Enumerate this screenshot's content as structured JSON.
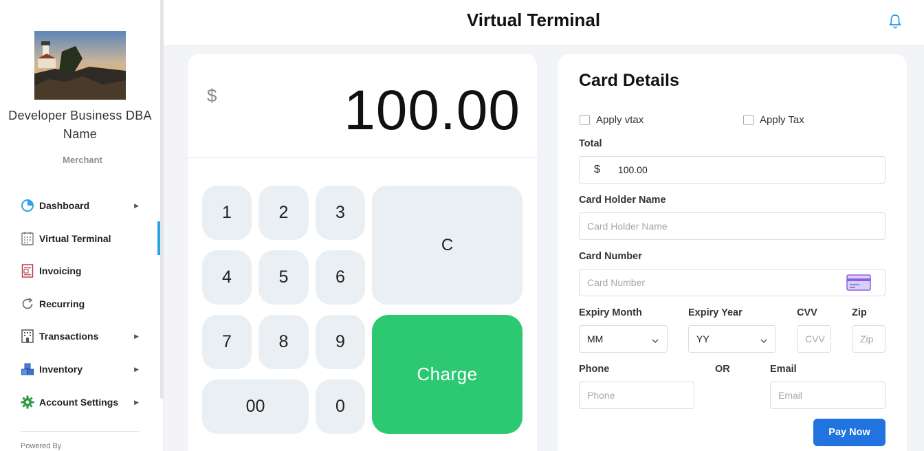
{
  "header": {
    "title": "Virtual Terminal",
    "bell_icon": "bell-icon"
  },
  "sidebar": {
    "business_name": "Developer Business DBA Name",
    "role": "Merchant",
    "powered_by": "Powered By",
    "items": [
      {
        "label": "Dashboard",
        "icon": "pie-chart-icon",
        "has_submenu": true
      },
      {
        "label": "Virtual Terminal",
        "icon": "calculator-icon",
        "has_submenu": false,
        "active": true
      },
      {
        "label": "Invoicing",
        "icon": "invoice-icon",
        "has_submenu": false
      },
      {
        "label": "Recurring",
        "icon": "refresh-icon",
        "has_submenu": false
      },
      {
        "label": "Transactions",
        "icon": "building-icon",
        "has_submenu": true
      },
      {
        "label": "Inventory",
        "icon": "boxes-icon",
        "has_submenu": true
      },
      {
        "label": "Account Settings",
        "icon": "gear-icon",
        "has_submenu": true
      }
    ]
  },
  "keypad": {
    "currency": "$",
    "amount": "100.00",
    "keys": [
      "1",
      "2",
      "3",
      "4",
      "5",
      "6",
      "7",
      "8",
      "9",
      "00",
      "0"
    ],
    "clear_label": "C",
    "charge_label": "Charge"
  },
  "card": {
    "title": "Card Details",
    "apply_vtax": "Apply vtax",
    "apply_tax": "Apply Tax",
    "total_label": "Total",
    "total_currency": "$",
    "total_value": "100.00",
    "holder_label": "Card Holder Name",
    "holder_placeholder": "Card Holder Name",
    "number_label": "Card Number",
    "number_placeholder": "Card Number",
    "expiry_month_label": "Expiry Month",
    "expiry_month_value": "MM",
    "expiry_year_label": "Expiry Year",
    "expiry_year_value": "YY",
    "cvv_label": "CVV",
    "cvv_placeholder": "CVV",
    "zip_label": "Zip",
    "zip_placeholder": "Zip",
    "phone_label": "Phone",
    "phone_placeholder": "Phone",
    "or_label": "OR",
    "email_label": "Email",
    "email_placeholder": "Email",
    "pay_button": "Pay Now"
  },
  "colors": {
    "accent": "#2aa2e8",
    "charge": "#2dc972",
    "pay": "#2174e0",
    "key_bg": "#e9eff3"
  }
}
